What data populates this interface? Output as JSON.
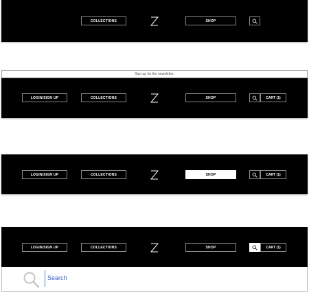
{
  "header": {
    "login_label": "LOGIN/SIGN UP",
    "collections_label": "COLLECTIONS",
    "logo_letter": "Z",
    "shop_label": "SHOP",
    "cart_label": "CART (1)",
    "search_icon": "search-icon"
  },
  "newsletter": {
    "text": "Sign up for the newsletter."
  },
  "search": {
    "placeholder": "Search",
    "icon": "search-icon"
  },
  "colors": {
    "bar_background": "#000000",
    "button_border": "#8a8a8a",
    "active_background": "#ffffff",
    "search_text": "#3a5fc8"
  }
}
